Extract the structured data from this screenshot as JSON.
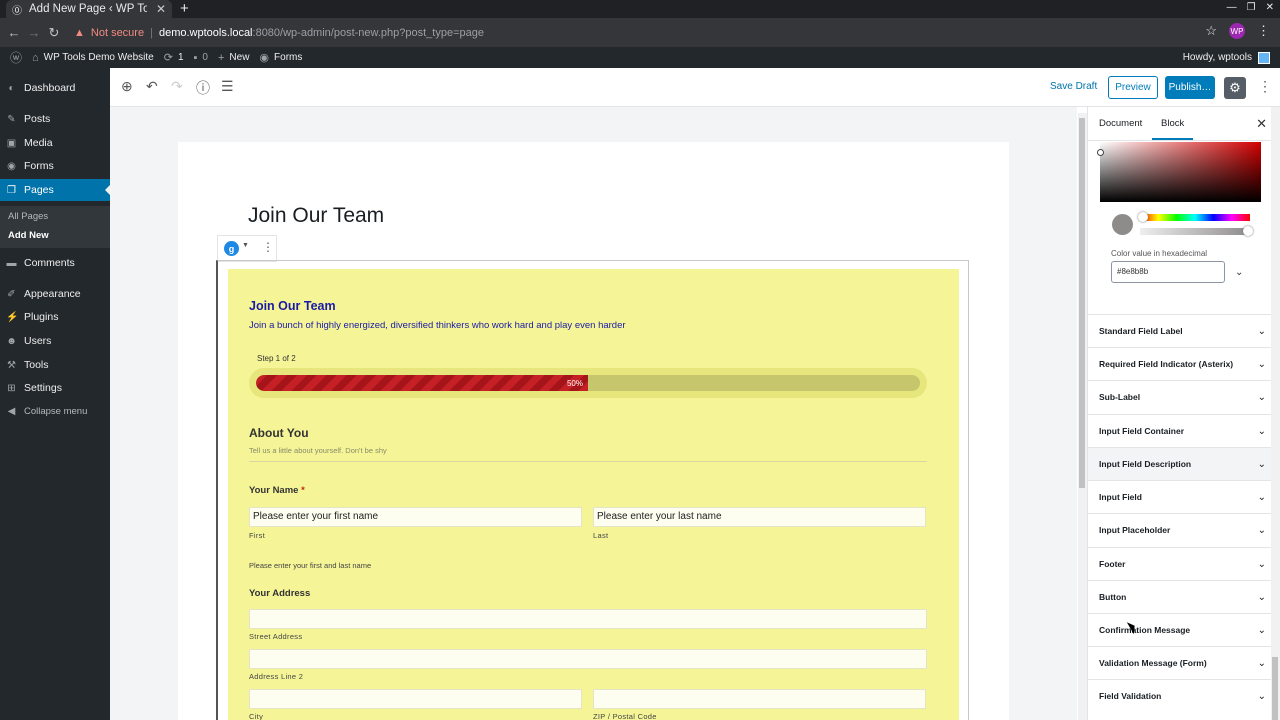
{
  "browser": {
    "tab_title": "Add New Page ‹ WP Too",
    "new_tab": "+",
    "not_secure": "Not secure",
    "url_host": "demo.wptools.local",
    "url_path": ":8080/wp-admin/post-new.php?post_type=page",
    "profile": "WP"
  },
  "adminbar": {
    "site_name": "WP Tools Demo Website",
    "updates": "1",
    "comments": "0",
    "new_label": "New",
    "forms_label": "Forms",
    "howdy": "Howdy, wptools"
  },
  "sidebar": {
    "items": [
      {
        "label": "Dashboard",
        "icon": "dashboard-icon"
      },
      {
        "label": "Posts",
        "icon": "pin-icon"
      },
      {
        "label": "Media",
        "icon": "media-icon"
      },
      {
        "label": "Forms",
        "icon": "forms-icon"
      },
      {
        "label": "Pages",
        "icon": "pages-icon"
      },
      {
        "label": "Comments",
        "icon": "comments-icon"
      },
      {
        "label": "Appearance",
        "icon": "brush-icon"
      },
      {
        "label": "Plugins",
        "icon": "plug-icon"
      },
      {
        "label": "Users",
        "icon": "user-icon"
      },
      {
        "label": "Tools",
        "icon": "wrench-icon"
      },
      {
        "label": "Settings",
        "icon": "settings-icon"
      },
      {
        "label": "Collapse menu",
        "icon": "collapse-icon"
      }
    ],
    "sub_items": [
      "All Pages",
      "Add New"
    ]
  },
  "toolbar": {
    "save_draft": "Save Draft",
    "preview": "Preview",
    "publish": "Publish…"
  },
  "editor": {
    "page_title": "Join Our Team"
  },
  "form": {
    "title": "Join Our Team",
    "description": "Join a bunch of highly energized, diversified thinkers who work hard and play even harder",
    "step": "Step 1 of 2",
    "progress_label": "50%",
    "progress_value": 0.5,
    "section_title": "About You",
    "section_desc": "Tell us a little about yourself. Don't be shy",
    "name_label": "Your Name",
    "required_mark": "*",
    "first_placeholder": "Please enter your first name",
    "last_placeholder": "Please enter your last name",
    "first_sub": "First",
    "last_sub": "Last",
    "name_desc": "Please enter your first and last name",
    "address_label": "Your Address",
    "street_sub": "Street Address",
    "line2_sub": "Address Line 2",
    "city_sub": "City",
    "zip_sub": "ZIP / Postal Code"
  },
  "panel": {
    "tab_document": "Document",
    "tab_block": "Block",
    "hex_label": "Color value in hexadecimal",
    "hex_value": "#8e8b8b",
    "swatch_color": "#8e8b8b",
    "sections": [
      "Standard Field Label",
      "Required Field Indicator (Asterix)",
      "Sub-Label",
      "Input Field Container",
      "Input Field Description",
      "Input Field",
      "Input Placeholder",
      "Footer",
      "Button",
      "Confirmation Message",
      "Validation Message (Form)",
      "Field Validation"
    ]
  }
}
